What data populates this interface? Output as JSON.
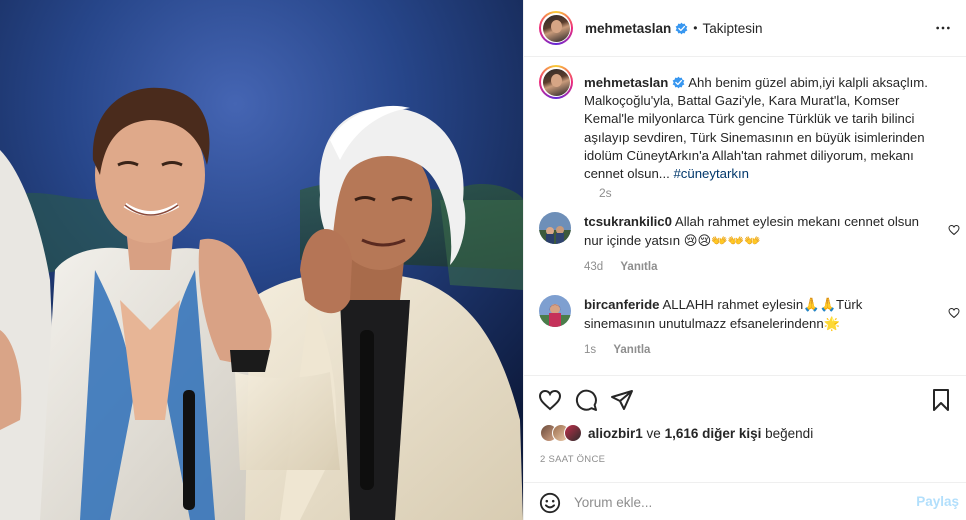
{
  "post": {
    "username": "mehmetaslan",
    "follow_status": "Takiptesin",
    "separator": "•",
    "caption": "Ahh benim güzel abim,iyi kalpli aksaçlım. Malkoçoğlu'yla, Battal Gazi'yle, Kara Murat'la, Komser Kemal'le milyonlarca Türk gencine Türklük ve tarih bilinci aşılayıp sevdiren, Türk Sinemasının en büyük isimlerinden idolüm CüneytArkın'a Allah'tan rahmet diliyorum, mekanı cennet olsun...",
    "hashtag": "#cüneytarkın",
    "caption_time": "2s",
    "icons": {
      "verified": "verified-badge-icon",
      "more": "more-options-icon",
      "like": "heart-icon",
      "comment": "comment-icon",
      "share": "share-icon",
      "save": "bookmark-icon",
      "emoji": "emoji-icon"
    }
  },
  "comments": [
    {
      "username": "tcsukrankilic0",
      "text": "Allah rahmet eylesin mekanı cennet olsun nur içinde yatsın 😢😢👐👐👐",
      "time": "43d",
      "reply": "Yanıtla"
    },
    {
      "username": "bircanferide",
      "text": "ALLAHH rahmet eylesin🙏🙏Türk sinemasının unutulmazz efsanelerindenn🌟",
      "time": "1s",
      "reply": "Yanıtla"
    }
  ],
  "likes": {
    "first_user": "aliozbir1",
    "connector": "ve",
    "others": "1,616 diğer kişi",
    "suffix": "beğendi"
  },
  "date_label": "2 SAAT ÖNCE",
  "add_comment": {
    "placeholder": "Yorum ekle...",
    "post_label": "Paylaş"
  },
  "colors": {
    "text": "#262626",
    "muted": "#8e8e8e",
    "link": "#00376b",
    "verified": "#3897f0",
    "post_disabled": "#b2dffc"
  }
}
